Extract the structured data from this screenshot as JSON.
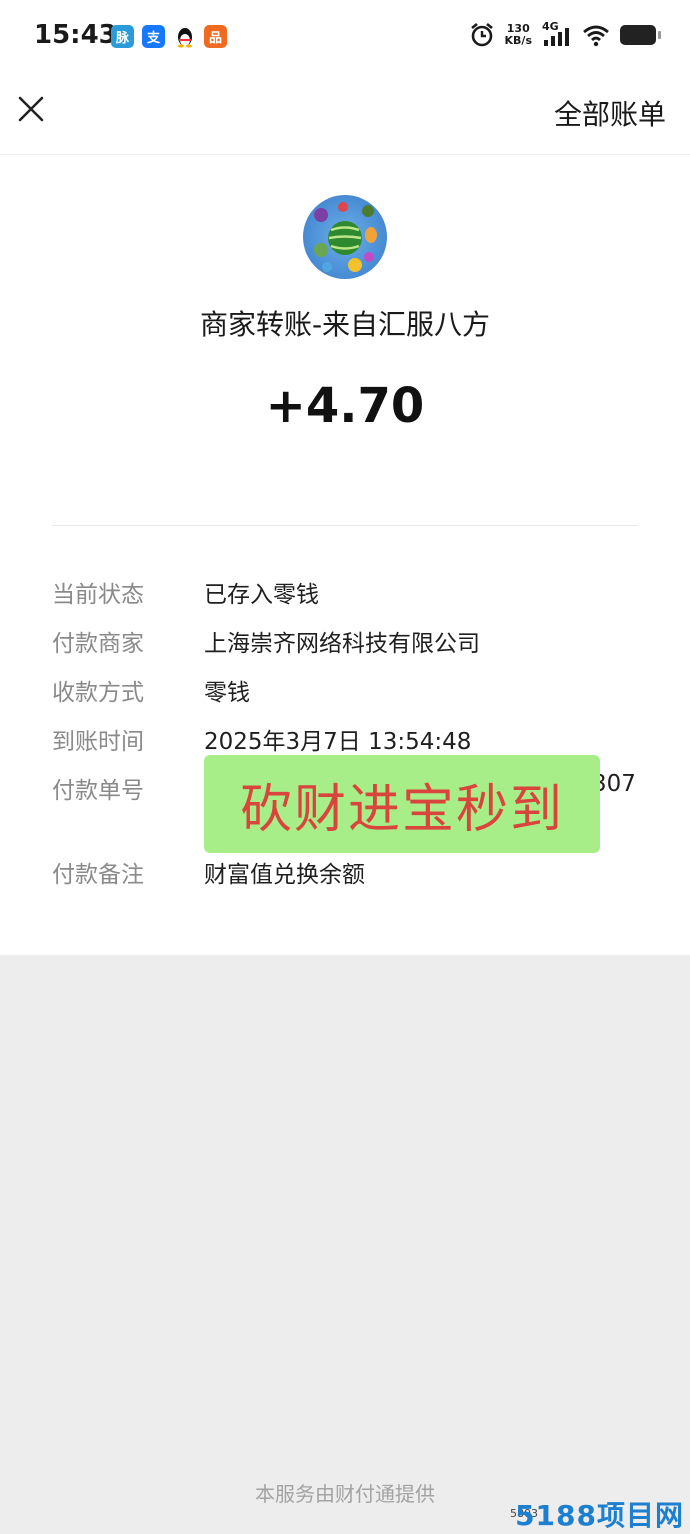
{
  "status_bar": {
    "time": "15:43",
    "net_speed_value": "130",
    "net_speed_unit": "KB/s",
    "network": "4G",
    "app_icons": [
      {
        "name": "pulse-app-icon",
        "glyph": "脉",
        "color": "#2a9bd8"
      },
      {
        "name": "alipay-app-icon",
        "glyph": "支",
        "color": "#1677ff"
      },
      {
        "name": "qq-app-icon",
        "glyph": "🐧",
        "color": "#ffffff"
      },
      {
        "name": "orange-app-icon",
        "glyph": "品",
        "color": "#f06b22"
      }
    ]
  },
  "navbar": {
    "close_icon": "close-icon",
    "all_bills_label": "全部账单"
  },
  "transaction": {
    "title": "商家转账-来自汇服八方",
    "amount": "+4.70",
    "details": [
      {
        "label": "当前状态",
        "value": "已存入零钱"
      },
      {
        "label": "付款商家",
        "value": "上海崇齐网络科技有限公司"
      },
      {
        "label": "收款方式",
        "value": "零钱"
      },
      {
        "label": "到账时间",
        "value": "2025年3月7日 13:54:48"
      },
      {
        "label": "付款单号",
        "value": "307"
      },
      {
        "label": "付款备注",
        "value": "财富值兑换余额"
      }
    ]
  },
  "overlay_stamp": "砍财进宝秒到",
  "footer": "本服务由财付通提供",
  "watermark": "5188项目网",
  "watermark_sub": "5803"
}
